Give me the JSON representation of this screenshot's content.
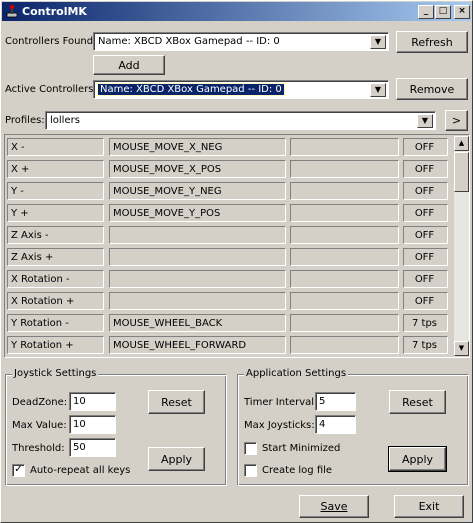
{
  "window": {
    "title": "ControlMK",
    "controls": [
      "_",
      "□",
      "×"
    ]
  },
  "controllers": {
    "found_label": "Controllers Found:",
    "found_value": "Name: XBCD XBox Gamepad -- ID: 0",
    "refresh_label": "Refresh",
    "add_label": "Add",
    "active_label": "Active Controllers:",
    "active_value": "Name: XBCD XBox Gamepad -- ID: 0",
    "remove_label": "Remove"
  },
  "profiles": {
    "label": "Profiles:",
    "value": "lollers",
    "more_label": ">"
  },
  "mappings": [
    {
      "axis": "X -",
      "action": "MOUSE_MOVE_X_NEG",
      "extra": "",
      "rate": "OFF"
    },
    {
      "axis": "X +",
      "action": "MOUSE_MOVE_X_POS",
      "extra": "",
      "rate": "OFF"
    },
    {
      "axis": "Y -",
      "action": "MOUSE_MOVE_Y_NEG",
      "extra": "",
      "rate": "OFF"
    },
    {
      "axis": "Y +",
      "action": "MOUSE_MOVE_Y_POS",
      "extra": "",
      "rate": "OFF"
    },
    {
      "axis": "Z Axis -",
      "action": "",
      "extra": "",
      "rate": "OFF"
    },
    {
      "axis": "Z Axis +",
      "action": "",
      "extra": "",
      "rate": "OFF"
    },
    {
      "axis": "X Rotation -",
      "action": "",
      "extra": "",
      "rate": "OFF"
    },
    {
      "axis": "X Rotation +",
      "action": "",
      "extra": "",
      "rate": "OFF"
    },
    {
      "axis": "Y Rotation -",
      "action": "MOUSE_WHEEL_BACK",
      "extra": "",
      "rate": "7 tps"
    },
    {
      "axis": "Y Rotation +",
      "action": "MOUSE_WHEEL_FORWARD",
      "extra": "",
      "rate": "7 tps"
    }
  ],
  "joystick_settings": {
    "title": "Joystick Settings",
    "deadzone_label": "DeadZone:",
    "deadzone_value": "10",
    "maxvalue_label": "Max Value:",
    "maxvalue_value": "10",
    "threshold_label": "Threshold:",
    "threshold_value": "50",
    "autorepeat_label": "Auto-repeat all keys",
    "autorepeat_checked": true,
    "reset_label": "Reset",
    "apply_label": "Apply"
  },
  "application_settings": {
    "title": "Application Settings",
    "timer_label": "Timer Interval:",
    "timer_value": "5",
    "maxjoy_label": "Max Joysticks:",
    "maxjoy_value": "4",
    "start_min_label": "Start Minimized",
    "start_min_checked": false,
    "log_label": "Create log file",
    "log_checked": false,
    "reset_label": "Reset",
    "apply_label": "Apply"
  },
  "footer": {
    "save_label": "Save",
    "exit_label": "Exit"
  }
}
